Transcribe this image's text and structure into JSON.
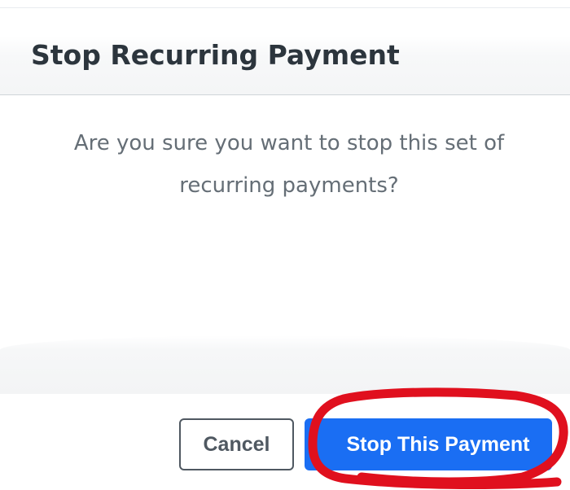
{
  "dialog": {
    "title": "Stop Recurring Payment",
    "message": "Are you sure you want to stop this set of recurring payments?",
    "cancel_label": "Cancel",
    "confirm_label": "Stop This Payment"
  },
  "colors": {
    "primary": "#1a6ef3",
    "title_text": "#2c353d",
    "body_text": "#656e76",
    "annotation": "#e0101e"
  }
}
